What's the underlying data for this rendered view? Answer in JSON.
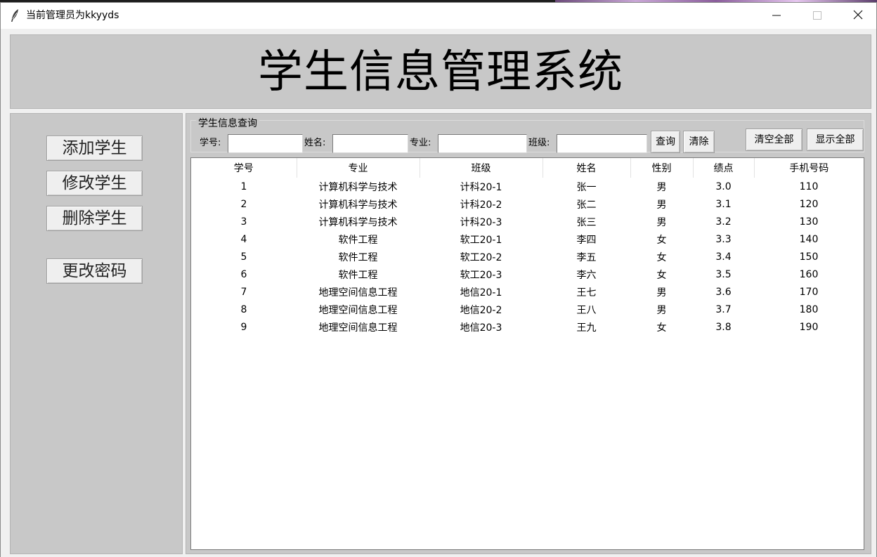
{
  "window": {
    "title": "当前管理员为kkyyds",
    "controls": {
      "minimize": "—",
      "maximize": "☐",
      "close": "✕"
    }
  },
  "header": {
    "title": "学生信息管理系统"
  },
  "sidebar": {
    "buttons": [
      {
        "label": "添加学生"
      },
      {
        "label": "修改学生"
      },
      {
        "label": "删除学生"
      },
      {
        "label": "更改密码"
      }
    ]
  },
  "query": {
    "legend": "学生信息查询",
    "fields": [
      {
        "label": "学号:",
        "value": ""
      },
      {
        "label": "姓名:",
        "value": ""
      },
      {
        "label": "专业:",
        "value": ""
      },
      {
        "label": "班级:",
        "value": ""
      }
    ],
    "buttons": {
      "search": "查询",
      "clear": "清除",
      "clear_all": "清空全部",
      "show_all": "显示全部"
    }
  },
  "table": {
    "columns": [
      "学号",
      "专业",
      "班级",
      "姓名",
      "性别",
      "绩点",
      "手机号码"
    ],
    "rows": [
      [
        "1",
        "计算机科学与技术",
        "计科20-1",
        "张一",
        "男",
        "3.0",
        "110"
      ],
      [
        "2",
        "计算机科学与技术",
        "计科20-2",
        "张二",
        "男",
        "3.1",
        "120"
      ],
      [
        "3",
        "计算机科学与技术",
        "计科20-3",
        "张三",
        "男",
        "3.2",
        "130"
      ],
      [
        "4",
        "软件工程",
        "软工20-1",
        "李四",
        "女",
        "3.3",
        "140"
      ],
      [
        "5",
        "软件工程",
        "软工20-2",
        "李五",
        "女",
        "3.4",
        "150"
      ],
      [
        "6",
        "软件工程",
        "软工20-3",
        "李六",
        "女",
        "3.5",
        "160"
      ],
      [
        "7",
        "地理空间信息工程",
        "地信20-1",
        "王七",
        "男",
        "3.6",
        "170"
      ],
      [
        "8",
        "地理空间信息工程",
        "地信20-2",
        "王八",
        "男",
        "3.7",
        "180"
      ],
      [
        "9",
        "地理空间信息工程",
        "地信20-3",
        "王九",
        "女",
        "3.8",
        "190"
      ]
    ]
  },
  "icons": {
    "app": "feather-icon",
    "minimize": "minimize-icon",
    "maximize": "maximize-icon",
    "close": "close-icon"
  },
  "colors": {
    "panel": "#c8c8c8",
    "client": "#f0f0f0",
    "button_face": "#efefef"
  }
}
